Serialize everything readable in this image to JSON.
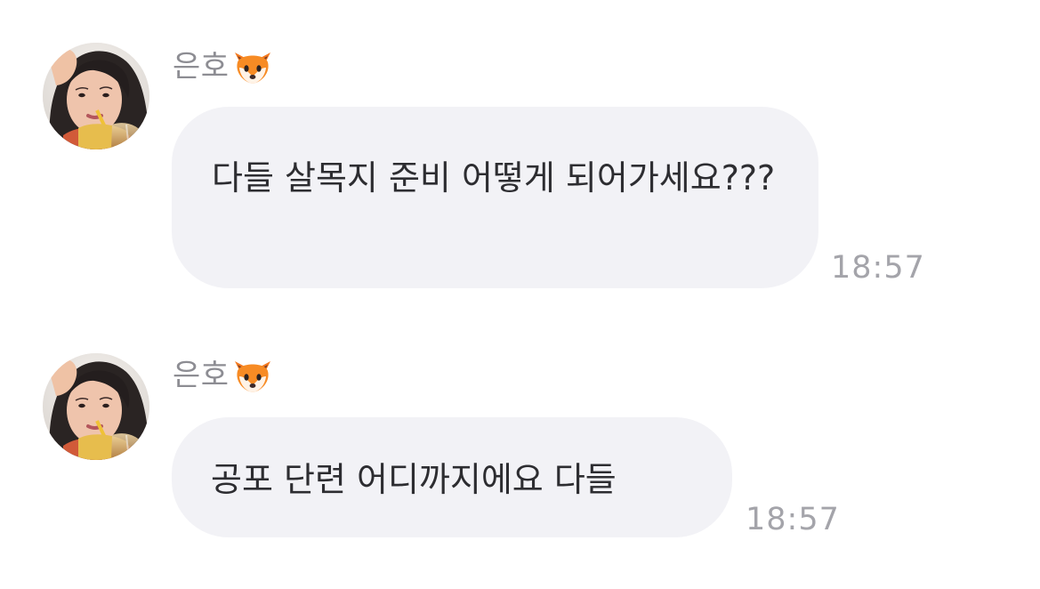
{
  "conversation": {
    "messages": [
      {
        "sender": "은호",
        "sender_emoji": "fox-face-icon",
        "avatar": "profile-avatar",
        "text": "다들 살목지 준비 어떻게 되어가세요???",
        "time": "18:57"
      },
      {
        "sender": "은호",
        "sender_emoji": "fox-face-icon",
        "avatar": "profile-avatar",
        "text": "공포 단련 어디까지에요 다들",
        "time": "18:57"
      }
    ]
  },
  "colors": {
    "bubble_background": "#f2f2f6",
    "bubble_text": "#2d2d31",
    "sender_text": "#8d8d93",
    "time_text": "#a4a4aa",
    "page_background": "#ffffff"
  }
}
